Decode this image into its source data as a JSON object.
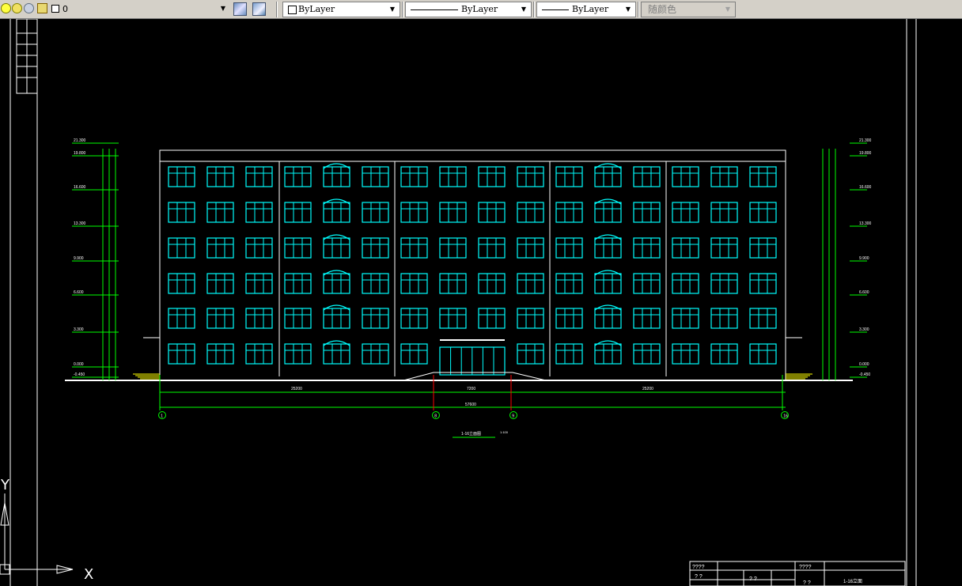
{
  "toolbar": {
    "layer_name": "0",
    "color_value": "ByLayer",
    "linetype_value": "ByLayer",
    "lineweight_value": "ByLayer",
    "plotstyle_value": "随颜色"
  },
  "colors": {
    "model_bg": "#000000",
    "frame": "#ffffff",
    "windows": "#00ffff",
    "dimensions": "#00ff00",
    "section_marks": "#ff0000",
    "stairs": "#ffff00",
    "toolbar_bg": "#d4d0c8"
  },
  "drawing": {
    "elevations_left": [
      "21.300",
      "19.800",
      "16.600",
      "13.300",
      "9.900",
      "6.600",
      "3.300",
      "0.000",
      "-0.450"
    ],
    "elevations_right": [
      "21.300",
      "19.800",
      "16.600",
      "13.300",
      "9.900",
      "6.600",
      "3.300",
      "0.000",
      "-0.450"
    ],
    "dims_bottom": [
      "25200",
      "7200",
      "25200"
    ],
    "dim_total": "57600",
    "axes": [
      "1",
      "8",
      "9",
      "16"
    ],
    "title": "1-16立面图",
    "scale": "1:100"
  },
  "titleblock": {
    "cell_a": "????",
    "cell_b": "????",
    "cell_c": "? ?",
    "cell_d": "? ?",
    "cell_e": "? ?",
    "cell_f": "1-16立面"
  },
  "ucs": {
    "y_label": "Y",
    "x_label": "X"
  }
}
